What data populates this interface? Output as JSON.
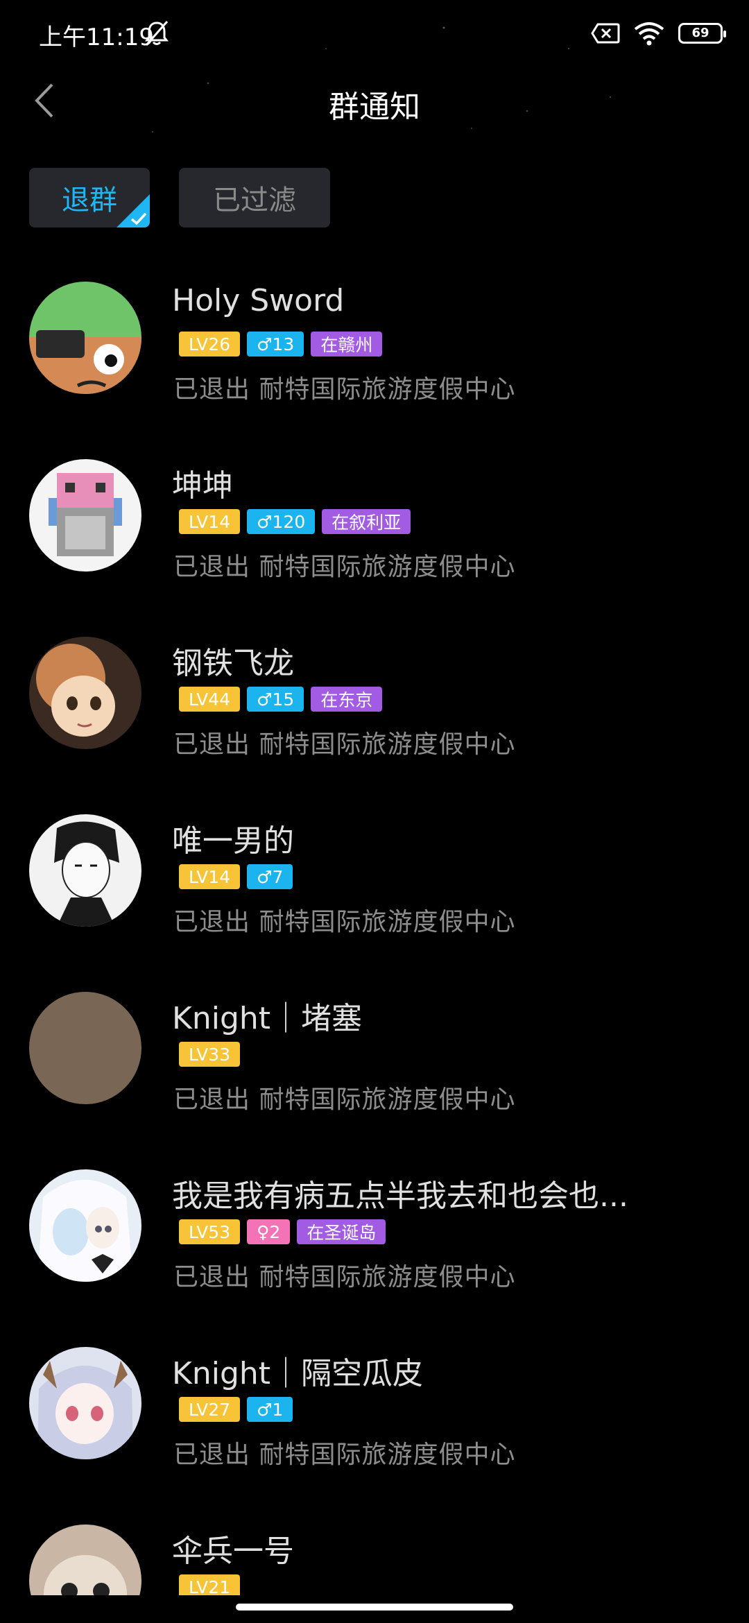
{
  "status_bar": {
    "time": "上午11:19",
    "battery": "69"
  },
  "header": {
    "title": "群通知"
  },
  "filters": [
    {
      "label": "退群",
      "active": true
    },
    {
      "label": "已过滤",
      "active": false
    }
  ],
  "members": [
    {
      "name": "Holy Sword",
      "level": "LV26",
      "gender": "♂",
      "age": "13",
      "location": "在赣州",
      "status": "已退出 耐特国际旅游度假中心"
    },
    {
      "name": "坤坤",
      "level": "LV14",
      "gender": "♂",
      "age": "120",
      "location": "在叙利亚",
      "status": "已退出 耐特国际旅游度假中心"
    },
    {
      "name": "钢铁飞龙",
      "level": "LV44",
      "gender": "♂",
      "age": "15",
      "location": "在东京",
      "status": "已退出 耐特国际旅游度假中心"
    },
    {
      "name": "唯一男的",
      "level": "LV14",
      "gender": "♂",
      "age": "7",
      "location": "",
      "status": "已退出 耐特国际旅游度假中心"
    },
    {
      "name": "Knight｜堵塞",
      "level": "LV33",
      "gender": "",
      "age": "",
      "location": "",
      "status": "已退出 耐特国际旅游度假中心"
    },
    {
      "name": "我是我有病五点半我去和也会也...",
      "level": "LV53",
      "gender": "♀",
      "age": "2",
      "location": "在圣诞岛",
      "status": "已退出 耐特国际旅游度假中心"
    },
    {
      "name": "Knight｜隔空瓜皮",
      "level": "LV27",
      "gender": "♂",
      "age": "1",
      "location": "",
      "status": "已退出 耐特国际旅游度假中心"
    },
    {
      "name": "伞兵一号",
      "level": "LV21",
      "gender": "",
      "age": "",
      "location": "",
      "status": ""
    }
  ],
  "colors": {
    "accent": "#1fb7f3",
    "level": "#f7c337",
    "male": "#1bb4ef",
    "female": "#f472b6",
    "location": "#a25be3"
  }
}
